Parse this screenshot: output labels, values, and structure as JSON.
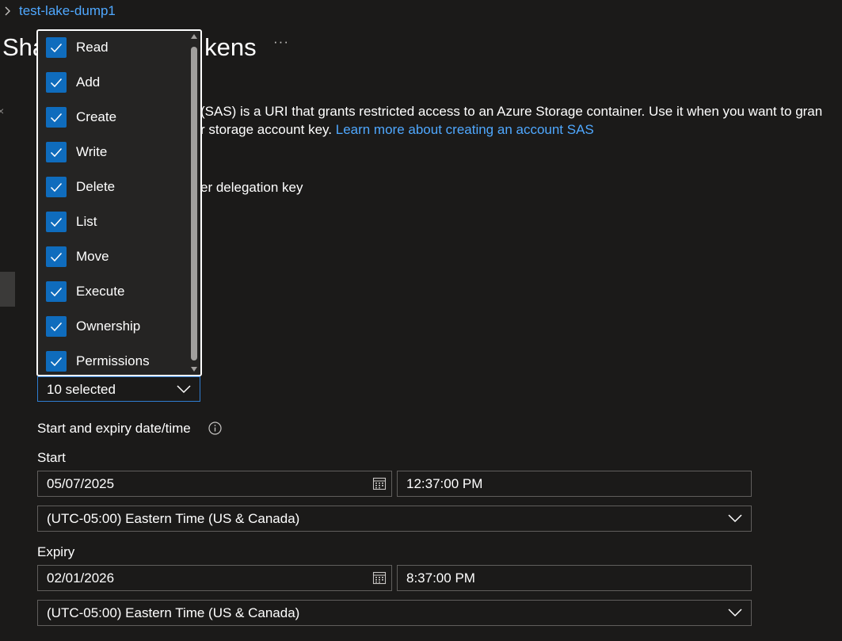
{
  "breadcrumb": {
    "item": "test-lake-dump1"
  },
  "header": {
    "title_left": "Sha",
    "title_right": "kens",
    "more": "···"
  },
  "description": {
    "line1": "(SAS) is a URI that grants restricted access to an Azure Storage container. Use it when you want to gran",
    "line2_prefix": "r storage account key.",
    "link": "Learn more about creating an account SAS"
  },
  "signing": {
    "option_fragment": "er delegation key"
  },
  "permissions": {
    "selected_text": "10 selected",
    "items": [
      {
        "label": "Read",
        "checked": true
      },
      {
        "label": "Add",
        "checked": true
      },
      {
        "label": "Create",
        "checked": true
      },
      {
        "label": "Write",
        "checked": true
      },
      {
        "label": "Delete",
        "checked": true
      },
      {
        "label": "List",
        "checked": true
      },
      {
        "label": "Move",
        "checked": true
      },
      {
        "label": "Execute",
        "checked": true
      },
      {
        "label": "Ownership",
        "checked": true
      },
      {
        "label": "Permissions",
        "checked": true
      }
    ]
  },
  "datetime": {
    "section_label": "Start and expiry date/time",
    "start": {
      "label": "Start",
      "date": "05/07/2025",
      "time": "12:37:00 PM",
      "timezone": "(UTC-05:00) Eastern Time (US & Canada)"
    },
    "expiry": {
      "label": "Expiry",
      "date": "02/01/2026",
      "time": "8:37:00 PM",
      "timezone": "(UTC-05:00) Eastern Time (US & Canada)"
    }
  },
  "colors": {
    "background": "#1b1a19",
    "accent": "#0f6cbd",
    "link": "#4fa8ff",
    "border": "#605e5c"
  }
}
